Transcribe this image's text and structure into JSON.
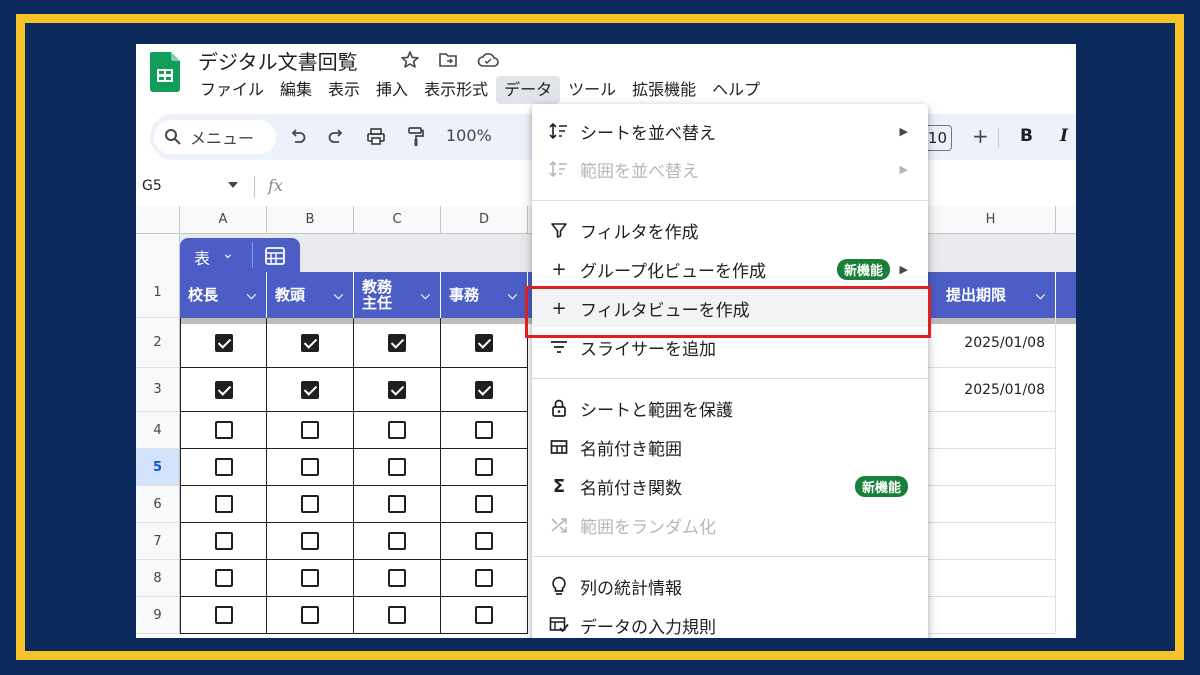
{
  "app": {
    "doc_title": "デジタル文書回覧",
    "menus": [
      "ファイル",
      "編集",
      "表示",
      "挿入",
      "表示形式",
      "データ",
      "ツール",
      "拡張機能",
      "ヘルプ"
    ],
    "active_menu": "データ"
  },
  "toolbar": {
    "search_label": "メニュー",
    "zoom": "100%",
    "font_size": "10",
    "plus": "+",
    "bold": "B",
    "italic": "I"
  },
  "formula_bar": {
    "name_box": "G5",
    "fx": "fx"
  },
  "grid": {
    "columns": [
      "A",
      "B",
      "C",
      "D",
      "H"
    ],
    "table_tab_label": "表",
    "headers": {
      "A": "校長",
      "B": "教頭",
      "C1": "教務",
      "C2": "主任",
      "D": "事務",
      "H": "提出期限"
    },
    "row_numbers": [
      "1",
      "2",
      "3",
      "4",
      "5",
      "6",
      "7",
      "8",
      "9"
    ],
    "selected_row": "5",
    "rows": [
      {
        "checks": [
          true,
          true,
          true,
          true
        ],
        "deadline": "2025/01/08"
      },
      {
        "checks": [
          true,
          true,
          true,
          true
        ],
        "deadline": "2025/01/08"
      },
      {
        "checks": [
          false,
          false,
          false,
          false
        ],
        "deadline": ""
      },
      {
        "checks": [
          false,
          false,
          false,
          false
        ],
        "deadline": ""
      },
      {
        "checks": [
          false,
          false,
          false,
          false
        ],
        "deadline": ""
      },
      {
        "checks": [
          false,
          false,
          false,
          false
        ],
        "deadline": ""
      },
      {
        "checks": [
          false,
          false,
          false,
          false
        ],
        "deadline": ""
      },
      {
        "checks": [
          false,
          false,
          false,
          false
        ],
        "deadline": ""
      }
    ]
  },
  "data_menu": {
    "items": [
      {
        "label": "シートを並べ替え",
        "icon": "sort-icon",
        "submenu": true,
        "disabled": false
      },
      {
        "label": "範囲を並べ替え",
        "icon": "sort-icon",
        "submenu": true,
        "disabled": true
      },
      {
        "label": "フィルタを作成",
        "icon": "filter-icon",
        "disabled": false
      },
      {
        "label": "グループ化ビューを作成",
        "icon": "plus-icon",
        "submenu": true,
        "badge": "新機能",
        "disabled": false
      },
      {
        "label": "フィルタビューを作成",
        "icon": "plus-icon",
        "disabled": false,
        "highlighted": true
      },
      {
        "label": "スライサーを追加",
        "icon": "slicer-icon",
        "disabled": false
      },
      {
        "label": "シートと範囲を保護",
        "icon": "lock-icon",
        "disabled": false
      },
      {
        "label": "名前付き範囲",
        "icon": "named-range-icon",
        "disabled": false
      },
      {
        "label": "名前付き関数",
        "icon": "sigma-icon",
        "badge": "新機能",
        "disabled": false
      },
      {
        "label": "範囲をランダム化",
        "icon": "shuffle-icon",
        "disabled": true
      },
      {
        "label": "列の統計情報",
        "icon": "lightbulb-icon",
        "disabled": false
      },
      {
        "label": "データの入力規則",
        "icon": "validation-icon",
        "disabled": false
      }
    ]
  },
  "colors": {
    "background": "#0c2a5c",
    "frame": "#f5c229",
    "table_header": "#4c5ec5",
    "badge": "#188038",
    "highlight": "#e0201e"
  }
}
